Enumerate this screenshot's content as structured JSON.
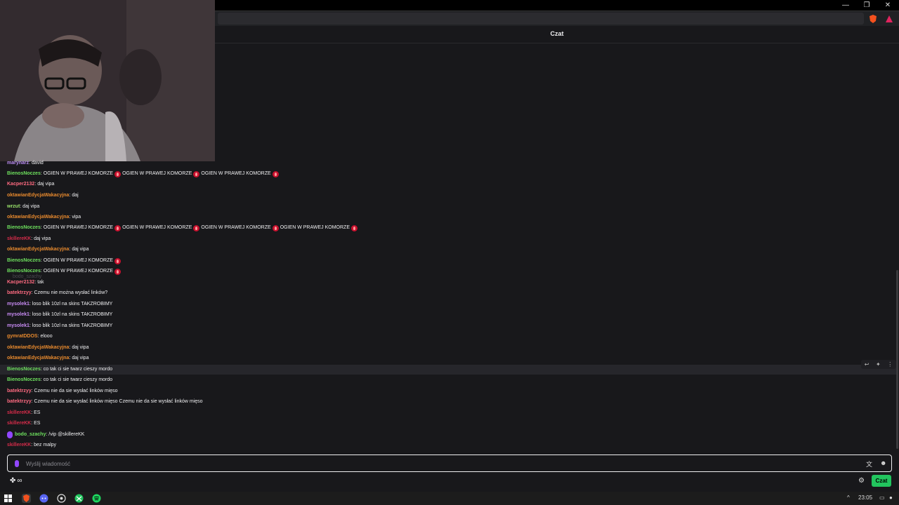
{
  "window": {
    "minimize_glyph": "—",
    "restore_glyph": "❐",
    "close_glyph": "✕"
  },
  "chat": {
    "title": "Czat",
    "faded_text": "bodo_szachy"
  },
  "messages": [
    {
      "user": "marynarz",
      "color": "#b98cf0",
      "text": "david",
      "fires": 0
    },
    {
      "user": "BienosNoczes",
      "color": "#6ee05e",
      "text": "OGIEN W PRAWEJ KOMORZE",
      "fires": 0,
      "repeat": [
        "OGIEN W PRAWEJ KOMORZE",
        "OGIEN W PRAWEJ KOMORZE",
        "OGIEN W PRAWEJ KOMORZE"
      ]
    },
    {
      "user": "Kacper2132",
      "color": "#ff6b81",
      "text": "daj vipa"
    },
    {
      "user": "oktawianEdycjaWakacyjna",
      "color": "#e88a2e",
      "text": "daj"
    },
    {
      "user": "wrzut",
      "color": "#9ae36b",
      "text": "daj vipa"
    },
    {
      "user": "oktawianEdycjaWakacyjna",
      "color": "#e88a2e",
      "text": "vipa"
    },
    {
      "user": "BienosNoczes",
      "color": "#6ee05e",
      "text": "",
      "repeat": [
        "OGIEN W PRAWEJ KOMORZE",
        "OGIEN W PRAWEJ KOMORZE",
        "OGIEN W PRAWEJ KOMORZE",
        "OGIEN W PRAWEJ KOMORZE"
      ]
    },
    {
      "user": "skillereKK",
      "color": "#d62c4a",
      "text": "daj vipa"
    },
    {
      "user": "oktawianEdycjaWakacyjna",
      "color": "#e88a2e",
      "text": "daj vipa"
    },
    {
      "user": "BienosNoczes",
      "color": "#6ee05e",
      "text": "",
      "repeat": [
        "OGIEN W PRAWEJ KOMORZE"
      ]
    },
    {
      "user": "BienosNoczes",
      "color": "#6ee05e",
      "text": "",
      "repeat": [
        "OGIEN W PRAWEJ KOMORZE"
      ]
    },
    {
      "user": "Kacper2132",
      "color": "#ff6b81",
      "text": "tak"
    },
    {
      "user": "batektrzyy",
      "color": "#ff6b81",
      "text": "Czemu nie można wysłać linków?"
    },
    {
      "user": "mysolek1",
      "color": "#c98cf5",
      "text": "loso blik 10zl na skins TAKZROBIMY"
    },
    {
      "user": "mysolek1",
      "color": "#c98cf5",
      "text": "loso blik 10zl na skins TAKZROBIMY"
    },
    {
      "user": "mysolek1",
      "color": "#c98cf5",
      "text": "loso blik 10zl na skins TAKZROBIMY"
    },
    {
      "user": "gymratDDOS",
      "color": "#e88a2e",
      "text": "elooo"
    },
    {
      "user": "oktawianEdycjaWakacyjna",
      "color": "#e88a2e",
      "text": "daj vipa"
    },
    {
      "user": "oktawianEdycjaWakacyjna",
      "color": "#e88a2e",
      "text": "daj vipa"
    },
    {
      "user": "BienosNoczes",
      "color": "#6ee05e",
      "text": "co tak ci sie twarz cieszy mordo"
    },
    {
      "user": "BienosNoczes",
      "color": "#6ee05e",
      "text": "co tak ci sie twarz cieszy mordo"
    },
    {
      "user": "batektrzyy",
      "color": "#ff6b81",
      "text": "Czemu nie da sie wysłać linków mięso"
    },
    {
      "user": "batektrzyy",
      "color": "#ff6b81",
      "text": "Czemu nie da sie wysłać linków mięso Czemu nie da sie wysłać linków mięso"
    },
    {
      "user": "skillereKK",
      "color": "#d62c4a",
      "text": "ES"
    },
    {
      "user": "skillereKK",
      "color": "#d62c4a",
      "text": "ES"
    },
    {
      "user": "bodo_szachy",
      "color": "#6ee05e",
      "text": "/vip @skillereKK"
    },
    {
      "user": "skillereKK",
      "color": "#d62c4a",
      "text": "bez malpy"
    }
  ],
  "input": {
    "placeholder": "Wyślij wiadomość"
  },
  "bottom": {
    "points": "∞",
    "chat_button": "Czat"
  },
  "taskbar": {
    "time": "23:05"
  },
  "colors": {
    "accent_green": "#22c55e",
    "fire_red": "#c8102e",
    "twitch_purple": "#9147ff"
  }
}
